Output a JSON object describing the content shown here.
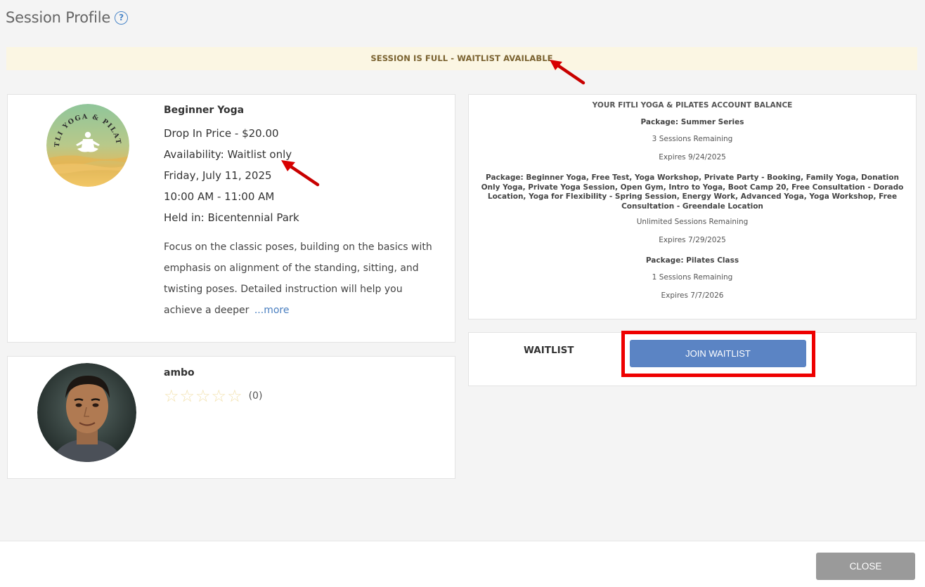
{
  "page": {
    "title": "Session Profile",
    "help_icon": "?"
  },
  "alert": {
    "text": "SESSION IS FULL - WAITLIST AVAILABLE"
  },
  "session": {
    "name": "Beginner Yoga",
    "price": "Drop In Price - $20.00",
    "availability": "Availability: Waitlist only",
    "date": "Friday, July 11, 2025",
    "time": "10:00 AM - 11:00 AM",
    "location": "Held in: Bicentennial Park",
    "description": "Focus on the classic poses, building on the basics with emphasis on alignment of the standing, sitting, and twisting poses. Detailed instruction will help you achieve a deeper",
    "more_label": "...more",
    "logo_text": "FITLI YOGA & PILATES"
  },
  "staff": {
    "name": "ambo",
    "rating_count": "(0)",
    "stars": 0,
    "max_stars": 5
  },
  "balance": {
    "title": "YOUR FITLI YOGA & PILATES ACCOUNT BALANCE",
    "packages": [
      {
        "name": "Package: Summer Series",
        "remaining": "3 Sessions Remaining",
        "expires": "Expires 9/24/2025"
      },
      {
        "name": "Package: Beginner Yoga, Free Test, Yoga Workshop, Private Party - Booking, Family Yoga, Donation Only Yoga, Private Yoga Session, Open Gym, Intro to Yoga, Boot Camp 20, Free Consultation - Dorado Location, Yoga for Flexibility - Spring Session, Energy Work, Advanced Yoga, Yoga Workshop, Free Consultation - Greendale Location",
        "remaining": "Unlimited Sessions Remaining",
        "expires": "Expires 7/29/2025"
      },
      {
        "name": "Package: Pilates Class",
        "remaining": "1 Sessions Remaining",
        "expires": "Expires 7/7/2026"
      }
    ]
  },
  "waitlist": {
    "label": "WAITLIST",
    "button_label": "JOIN WAITLIST"
  },
  "footer": {
    "close_label": "CLOSE"
  },
  "colors": {
    "accent": "#5b84c4",
    "alert_bg": "#fbf6e3",
    "alert_text": "#7a6230",
    "annotation": "#ee0000",
    "close_button": "#9a9a9a"
  }
}
